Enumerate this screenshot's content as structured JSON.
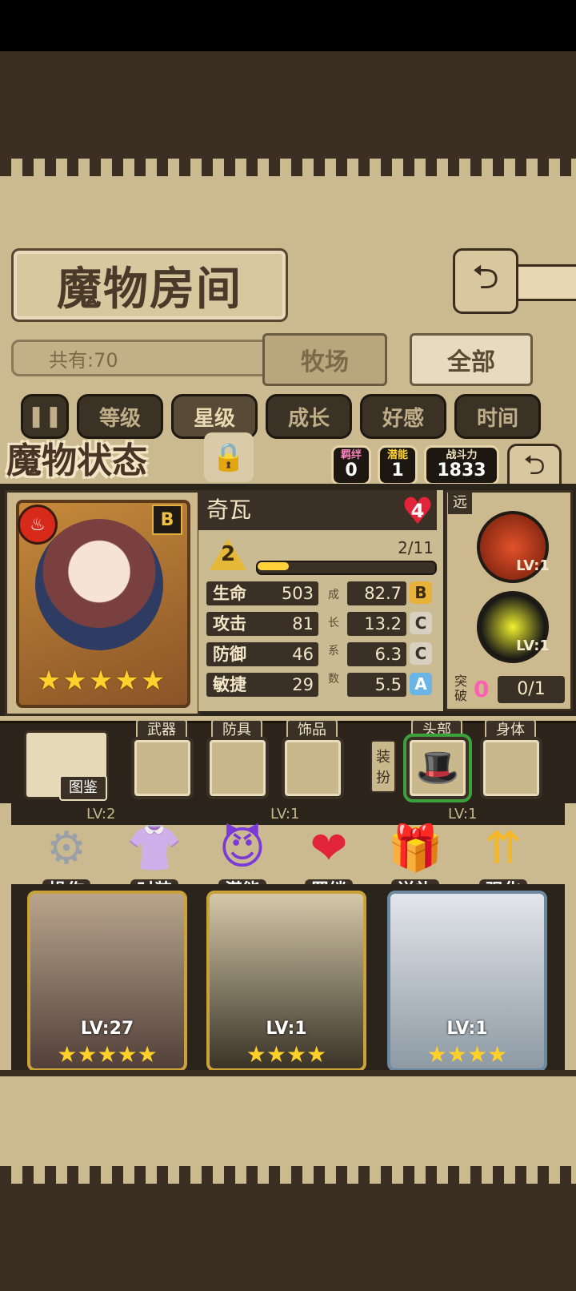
{
  "room": {
    "title": "魔物房间",
    "count_text": "共有:70",
    "tabs": [
      "牧场",
      "全部"
    ],
    "active_tab": "全部"
  },
  "filters": {
    "toggle_icon": "pause-icon",
    "items": [
      "等级",
      "星级",
      "成长",
      "好感",
      "时间"
    ],
    "active": "星级"
  },
  "status": {
    "title": "魔物状态",
    "bond": {
      "label": "羁绊",
      "value": "0"
    },
    "potential": {
      "label": "潜能",
      "value": "1"
    },
    "power": {
      "label": "战斗力",
      "value": "1833"
    }
  },
  "monster": {
    "name": "奇瓦",
    "affinity": "4",
    "rank": "B",
    "element_icon": "fire-icon",
    "stars": 5,
    "level": "2",
    "exp_text": "2/11",
    "exp_progress": 0.18,
    "stats": [
      {
        "label": "生命",
        "value": "503",
        "growth": "82.7",
        "grade": "B"
      },
      {
        "label": "攻击",
        "value": "81",
        "growth": "13.2",
        "grade": "C"
      },
      {
        "label": "防御",
        "value": "46",
        "growth": "6.3",
        "grade": "C"
      },
      {
        "label": "敏捷",
        "value": "29",
        "growth": "5.5",
        "grade": "A"
      }
    ],
    "growth_label": [
      "成",
      "长",
      "系",
      "数"
    ],
    "attack_type": "远",
    "skills": [
      {
        "name": "fire-skill-icon",
        "level": "LV:1"
      },
      {
        "name": "lightning-skill-icon",
        "level": "LV:1"
      }
    ],
    "breakthrough": {
      "label": "突破",
      "value": "0",
      "progress": "0/1"
    }
  },
  "equipment": {
    "codex_label": "图鉴",
    "slots": [
      "武器",
      "防具",
      "饰品"
    ],
    "dress_label": [
      "装",
      "扮"
    ],
    "cosmetic_slots": [
      "头部",
      "身体"
    ]
  },
  "actions": [
    {
      "label": "操作",
      "icon": "gear-icon"
    },
    {
      "label": "时装",
      "icon": "outfit-icon"
    },
    {
      "label": "潜能",
      "icon": "demon-icon"
    },
    {
      "label": "羁绊",
      "icon": "hearts-icon"
    },
    {
      "label": "送礼",
      "icon": "gift-icon"
    },
    {
      "label": "强化",
      "icon": "upgrade-arrows-icon"
    }
  ],
  "list": {
    "partial_levels": [
      "LV:2",
      "LV:1",
      "LV:1"
    ],
    "cards": [
      {
        "level": "LV:27",
        "stars": 5
      },
      {
        "level": "LV:1",
        "stars": 4
      },
      {
        "level": "LV:1",
        "stars": 4
      }
    ]
  },
  "colors": {
    "parchment": "#cbb98f",
    "dark_panel": "#3a3026",
    "star_gold": "#ffd12a",
    "grade_b": "#e8b23a",
    "grade_c": "#d9cfc0",
    "grade_a": "#6ab4e6",
    "bond_pink": "#ff7fbf"
  }
}
